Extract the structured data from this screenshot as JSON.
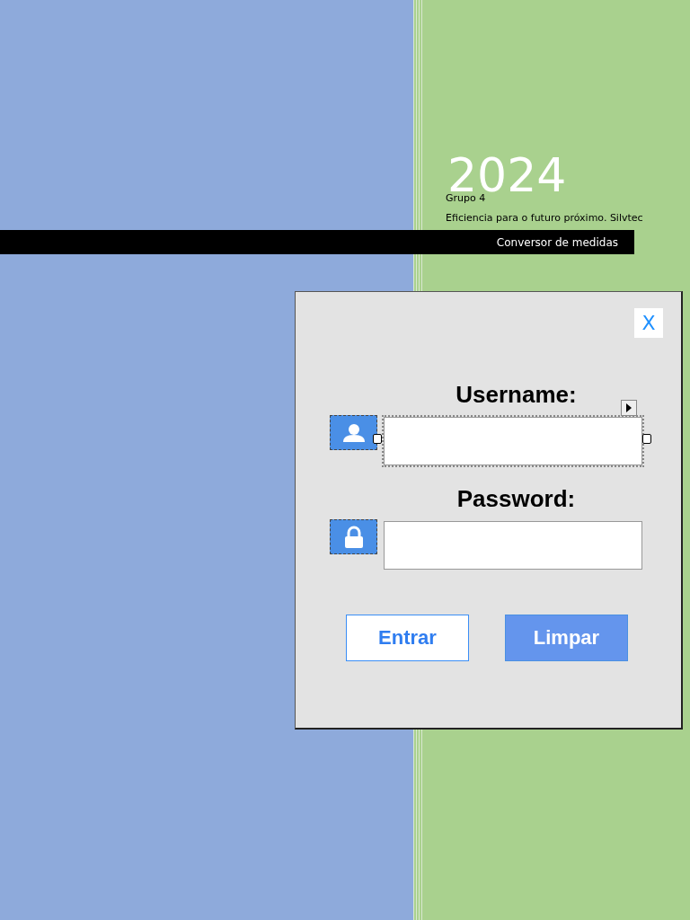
{
  "cover": {
    "year": "2024",
    "group": "Grupo 4",
    "tagline": "Eficiencia para o futuro próximo. Silvtec",
    "banner": "Conversor de medidas"
  },
  "dialog": {
    "close": "X",
    "fields": [
      {
        "label": "Username:",
        "kind": "user",
        "selected": true
      },
      {
        "label": "Password:",
        "kind": "lock",
        "selected": false
      }
    ],
    "buttons": [
      {
        "label": "Entrar",
        "kind": "outline"
      },
      {
        "label": "Limpar",
        "kind": "filled"
      }
    ]
  }
}
